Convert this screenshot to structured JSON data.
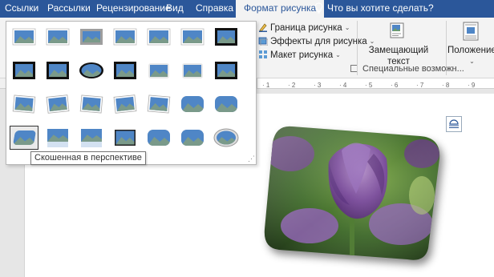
{
  "tabs": [
    {
      "label": "Ссылки",
      "active": false
    },
    {
      "label": "Рассылки",
      "active": false
    },
    {
      "label": "Рецензирование",
      "active": false
    },
    {
      "label": "Вид",
      "active": false
    },
    {
      "label": "Справка",
      "active": false
    },
    {
      "label": "Формат рисунка",
      "active": true
    }
  ],
  "tell_me": {
    "icon": "lightbulb-icon",
    "label": "Что вы хотите сделать?"
  },
  "ribbon": {
    "border_label": "Граница рисунка",
    "effects_label": "Эффекты для рисунка",
    "layout_label": "Макет рисунка",
    "alt_text_label_1": "Замещающий",
    "alt_text_label_2": "текст",
    "position_label": "Положение",
    "accessibility_group_label": "Специальные возможн..."
  },
  "ruler": {
    "marks": [
      "1",
      "2",
      "3",
      "4",
      "5",
      "6",
      "7",
      "8",
      "9"
    ]
  },
  "gallery": {
    "style_count": 28,
    "selected_style": "Скошенная в перспективе"
  },
  "tooltip": {
    "text": "Скошенная в перспективе"
  },
  "colors": {
    "tab_bar": "#2b579a",
    "ribbon_bg": "#f3f3f3",
    "doc_bg": "#e6e6e6",
    "thumb_sky": "#4f86c6",
    "thumb_hills": "#7a9a8a"
  },
  "picture": {
    "subject": "purple tulip",
    "style": "Скошенная в перспективе"
  }
}
